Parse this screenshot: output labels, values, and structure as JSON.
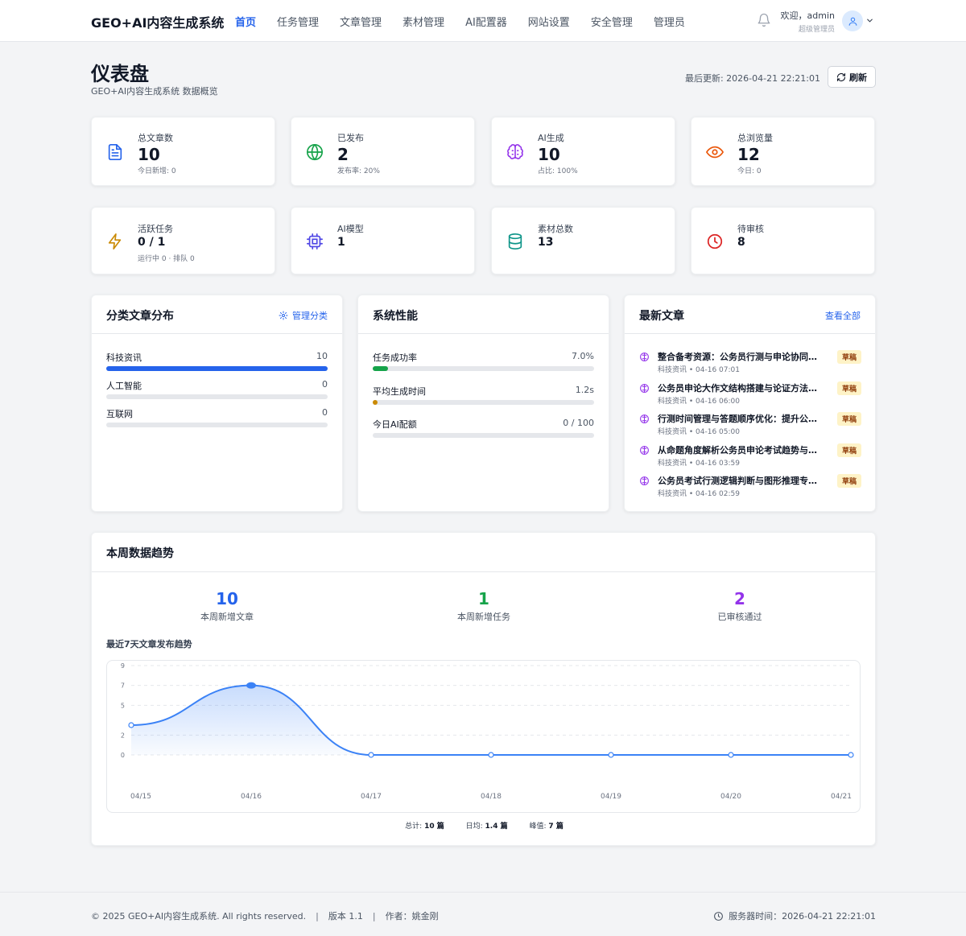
{
  "header": {
    "brand": "GEO+AI内容生成系统",
    "nav": [
      {
        "label": "首页",
        "active": true
      },
      {
        "label": "任务管理",
        "active": false
      },
      {
        "label": "文章管理",
        "active": false
      },
      {
        "label": "素材管理",
        "active": false
      },
      {
        "label": "AI配置器",
        "active": false
      },
      {
        "label": "网站设置",
        "active": false
      },
      {
        "label": "安全管理",
        "active": false
      },
      {
        "label": "管理员",
        "active": false
      }
    ],
    "welcome": "欢迎，admin",
    "role": "超级管理员"
  },
  "page": {
    "title": "仪表盘",
    "subtitle": "GEO+AI内容生成系统 数据概览",
    "last_update": "最后更新: 2026-04-21 22:21:01",
    "refresh_label": "刷新"
  },
  "stats_row1": [
    {
      "icon": "document-icon",
      "color": "#2563eb",
      "label": "总文章数",
      "value": "10",
      "sub": "今日新增: 0"
    },
    {
      "icon": "globe-icon",
      "color": "#16a34a",
      "label": "已发布",
      "value": "2",
      "sub": "发布率: 20%"
    },
    {
      "icon": "brain-icon",
      "color": "#9333ea",
      "label": "AI生成",
      "value": "10",
      "sub": "占比: 100%"
    },
    {
      "icon": "eye-icon",
      "color": "#ea580c",
      "label": "总浏览量",
      "value": "12",
      "sub": "今日: 0"
    }
  ],
  "stats_row2": [
    {
      "icon": "lightning-icon",
      "color": "#ca8a04",
      "label": "活跃任务",
      "value": "0 / 1",
      "sub": "运行中 0 · 排队 0"
    },
    {
      "icon": "cpu-icon",
      "color": "#4f46e5",
      "label": "AI模型",
      "value": "1",
      "sub": ""
    },
    {
      "icon": "database-icon",
      "color": "#0d9488",
      "label": "素材总数",
      "value": "13",
      "sub": ""
    },
    {
      "icon": "clock-icon",
      "color": "#dc2626",
      "label": "待审核",
      "value": "8",
      "sub": ""
    }
  ],
  "categories": {
    "title": "分类文章分布",
    "link": "管理分类",
    "items": [
      {
        "label": "科技资讯",
        "value": "10",
        "fraction": 1.0
      },
      {
        "label": "人工智能",
        "value": "0",
        "fraction": 0
      },
      {
        "label": "互联网",
        "value": "0",
        "fraction": 0
      }
    ]
  },
  "performance": {
    "title": "系统性能",
    "items": [
      {
        "label": "任务成功率",
        "value": "7.0%",
        "fraction": 0.07,
        "color": "#16a34a"
      },
      {
        "label": "平均生成时间",
        "value": "1.2s",
        "fraction": 0.02,
        "color": "#ca8a04"
      },
      {
        "label": "今日AI配额",
        "value": "0 / 100",
        "fraction": 0,
        "color": "#2563eb"
      }
    ]
  },
  "latest": {
    "title": "最新文章",
    "link": "查看全部",
    "items": [
      {
        "title": "整合备考资源：公务员行测与申论协同备考策略",
        "meta": "科技资讯 • 04-16 07:01",
        "badge": "草稿"
      },
      {
        "title": "公务员申论大作文结构搭建与论证方法解析",
        "meta": "科技资讯 • 04-16 06:00",
        "badge": "草稿"
      },
      {
        "title": "行测时间管理与答题顺序优化：提升公考效率",
        "meta": "科技资讯 • 04-16 05:00",
        "badge": "草稿"
      },
      {
        "title": "从命题角度解析公务员申论考试趋势与应对",
        "meta": "科技资讯 • 04-16 03:59",
        "badge": "草稿"
      },
      {
        "title": "公务员考试行测逻辑判断与图形推理专项突破",
        "meta": "科技资讯 • 04-16 02:59",
        "badge": "草稿"
      }
    ]
  },
  "trend": {
    "title": "本周数据趋势",
    "kpis": [
      {
        "value": "10",
        "label": "本周新增文章",
        "color": "#2563eb"
      },
      {
        "value": "1",
        "label": "本周新增任务",
        "color": "#16a34a"
      },
      {
        "value": "2",
        "label": "已审核通过",
        "color": "#9333ea"
      }
    ],
    "chart_title": "最近7天文章发布趋势",
    "summary": {
      "total_label": "总计:",
      "total_value": "10 篇",
      "avg_label": "日均:",
      "avg_value": "1.4 篇",
      "peak_label": "峰值:",
      "peak_value": "7 篇"
    }
  },
  "chart_data": {
    "type": "area",
    "title": "最近7天文章发布趋势",
    "x": [
      "04/15",
      "04/16",
      "04/17",
      "04/18",
      "04/19",
      "04/20",
      "04/21"
    ],
    "series": [
      {
        "values": [
          3,
          7,
          0,
          0,
          0,
          0,
          0
        ]
      }
    ],
    "yticks": [
      0,
      2,
      5,
      7,
      9
    ],
    "ylim": [
      0,
      9
    ],
    "grid": true,
    "line_color": "#3b82f6"
  },
  "footer": {
    "copyright": "© 2025 GEO+AI内容生成系统. All rights reserved.",
    "sep": "|",
    "version": "版本 1.1",
    "author": "作者：姚金刚",
    "server_time": "服务器时间：2026-04-21 22:21:01"
  }
}
